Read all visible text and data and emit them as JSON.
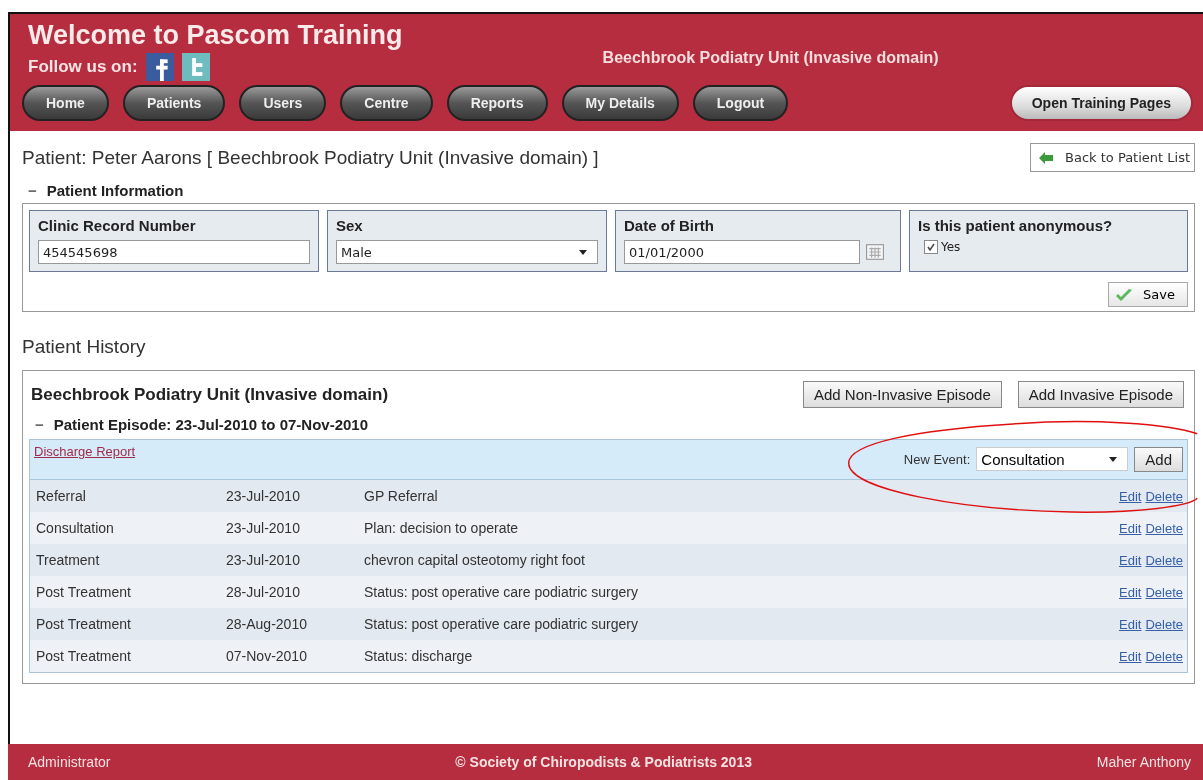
{
  "header": {
    "title": "Welcome to Pascom Training",
    "follow_label": "Follow us on:",
    "unit": "Beechbrook Podiatry Unit (Invasive domain)",
    "nav": [
      {
        "label": "Home"
      },
      {
        "label": "Patients"
      },
      {
        "label": "Users"
      },
      {
        "label": "Centre"
      },
      {
        "label": "Reports"
      },
      {
        "label": "My Details"
      },
      {
        "label": "Logout"
      }
    ],
    "training_button": "Open Training Pages"
  },
  "page_title": "Patient: Peter Aarons [ Beechbrook Podiatry Unit (Invasive domain) ]",
  "back_button": "Back to Patient List",
  "patient_info": {
    "toggle": "−",
    "title": "Patient Information",
    "crn": {
      "label": "Clinic Record Number",
      "value": "454545698"
    },
    "sex": {
      "label": "Sex",
      "value": "Male"
    },
    "dob": {
      "label": "Date of Birth",
      "value": "01/01/2000"
    },
    "anonymous": {
      "label": "Is this patient anonymous?",
      "option": "Yes",
      "checked": true
    },
    "save_button": "Save"
  },
  "history": {
    "title": "Patient History",
    "unit": "Beechbrook Podiatry Unit (Invasive domain)",
    "buttons": [
      "Add Non-Invasive Episode",
      "Add Invasive Episode"
    ],
    "episode": {
      "toggle": "−",
      "title": "Patient Episode: 23-Jul-2010 to 07-Nov-2010",
      "report_link": "Discharge Report",
      "new_event_label": "New Event:",
      "new_event_value": "Consultation",
      "add_button": "Add",
      "rows": [
        {
          "type": "Referral",
          "date": "23-Jul-2010",
          "detail": "GP Referral",
          "edit": "Edit",
          "delete": "Delete"
        },
        {
          "type": "Consultation",
          "date": "23-Jul-2010",
          "detail": "Plan: decision to operate",
          "edit": "Edit",
          "delete": "Delete"
        },
        {
          "type": "Treatment",
          "date": "23-Jul-2010",
          "detail": "chevron capital osteotomy right foot",
          "edit": "Edit",
          "delete": "Delete"
        },
        {
          "type": "Post Treatment",
          "date": "28-Jul-2010",
          "detail": "Status: post operative care podiatric surgery",
          "edit": "Edit",
          "delete": "Delete"
        },
        {
          "type": "Post Treatment",
          "date": "28-Aug-2010",
          "detail": "Status: post operative care podiatric surgery",
          "edit": "Edit",
          "delete": "Delete"
        },
        {
          "type": "Post Treatment",
          "date": "07-Nov-2010",
          "detail": "Status: discharge",
          "edit": "Edit",
          "delete": "Delete"
        }
      ]
    }
  },
  "footer": {
    "role": "Administrator",
    "copyright": "© Society of Chiropodists & Podiatrists 2013",
    "user": "Maher Anthony"
  }
}
